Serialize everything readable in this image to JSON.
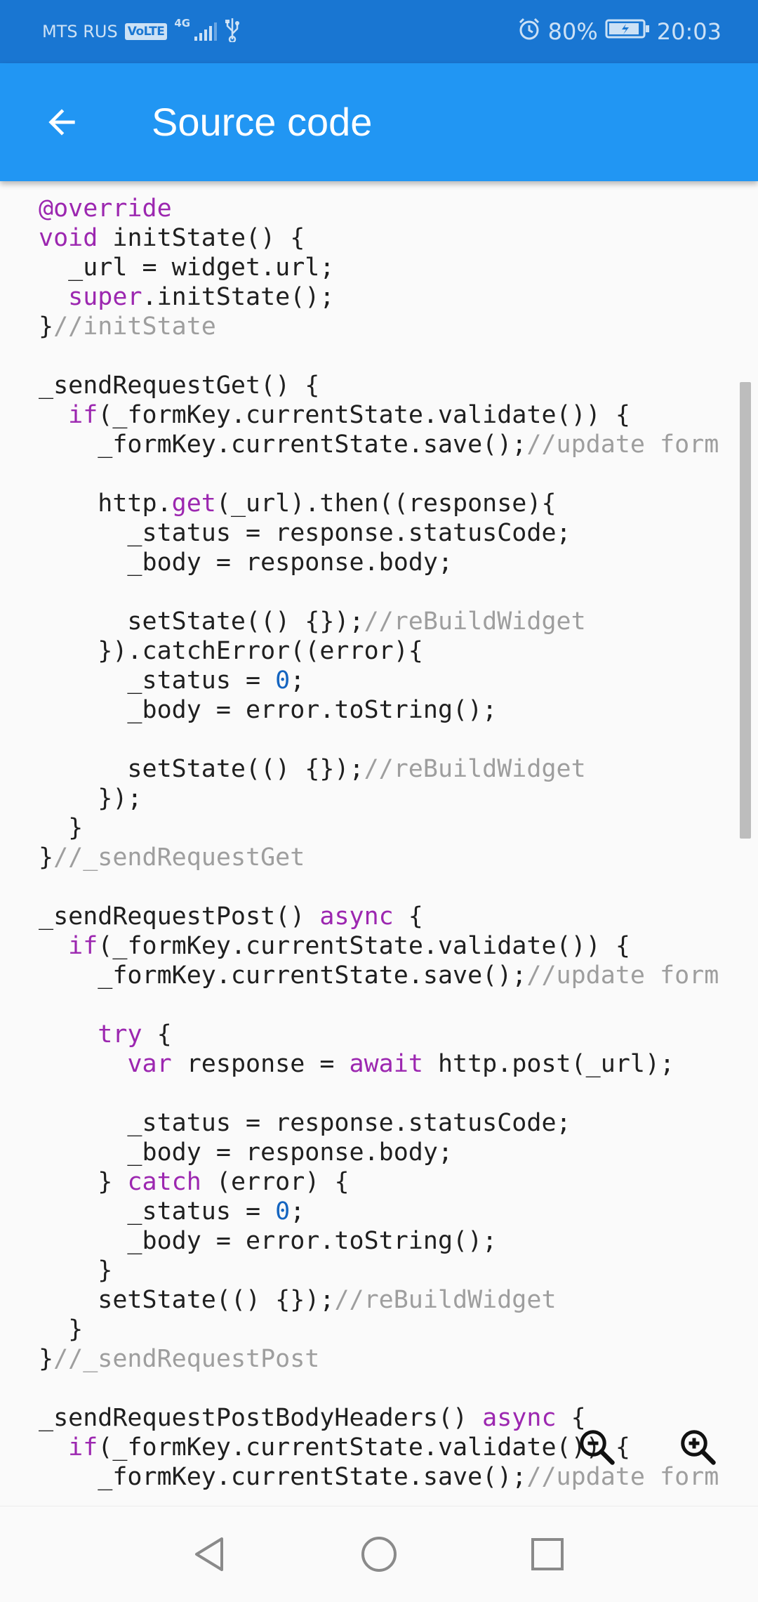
{
  "status_bar": {
    "carrier": "MTS RUS",
    "volte_label": "VoLTE",
    "network_label": "4G",
    "battery_percent": "80%",
    "time": "20:03"
  },
  "app_bar": {
    "title": "Source code",
    "back_icon": "arrow-back-icon"
  },
  "code": {
    "language": "dart",
    "lines": [
      [
        [
          "kw",
          "@override"
        ]
      ],
      [
        [
          "kw",
          "void"
        ],
        [
          "p",
          " initState() {"
        ]
      ],
      [
        [
          "p",
          "  _url = widget.url;"
        ]
      ],
      [
        [
          "p",
          "  "
        ],
        [
          "kw",
          "super"
        ],
        [
          "p",
          ".initState();"
        ]
      ],
      [
        [
          "p",
          "}"
        ],
        [
          "cm",
          "//initState"
        ]
      ],
      [
        [
          "p",
          ""
        ]
      ],
      [
        [
          "p",
          "_sendRequestGet() {"
        ]
      ],
      [
        [
          "p",
          "  "
        ],
        [
          "kw",
          "if"
        ],
        [
          "p",
          "(_formKey.currentState.validate()) {"
        ]
      ],
      [
        [
          "p",
          "    _formKey.currentState.save();"
        ],
        [
          "cm",
          "//update form"
        ]
      ],
      [
        [
          "p",
          ""
        ]
      ],
      [
        [
          "p",
          "    http."
        ],
        [
          "kw",
          "get"
        ],
        [
          "p",
          "(_url).then((response){"
        ]
      ],
      [
        [
          "p",
          "      _status = response.statusCode;"
        ]
      ],
      [
        [
          "p",
          "      _body = response.body;"
        ]
      ],
      [
        [
          "p",
          ""
        ]
      ],
      [
        [
          "p",
          "      setState(() {});"
        ],
        [
          "cm",
          "//reBuildWidget"
        ]
      ],
      [
        [
          "p",
          "    }).catchError((error){"
        ]
      ],
      [
        [
          "p",
          "      _status = "
        ],
        [
          "num",
          "0"
        ],
        [
          "p",
          ";"
        ]
      ],
      [
        [
          "p",
          "      _body = error.toString();"
        ]
      ],
      [
        [
          "p",
          ""
        ]
      ],
      [
        [
          "p",
          "      setState(() {});"
        ],
        [
          "cm",
          "//reBuildWidget"
        ]
      ],
      [
        [
          "p",
          "    });"
        ]
      ],
      [
        [
          "p",
          "  }"
        ]
      ],
      [
        [
          "p",
          "}"
        ],
        [
          "cm",
          "//_sendRequestGet"
        ]
      ],
      [
        [
          "p",
          ""
        ]
      ],
      [
        [
          "p",
          "_sendRequestPost() "
        ],
        [
          "kw",
          "async"
        ],
        [
          "p",
          " {"
        ]
      ],
      [
        [
          "p",
          "  "
        ],
        [
          "kw",
          "if"
        ],
        [
          "p",
          "(_formKey.currentState.validate()) {"
        ]
      ],
      [
        [
          "p",
          "    _formKey.currentState.save();"
        ],
        [
          "cm",
          "//update form"
        ]
      ],
      [
        [
          "p",
          ""
        ]
      ],
      [
        [
          "p",
          "    "
        ],
        [
          "kw",
          "try"
        ],
        [
          "p",
          " {"
        ]
      ],
      [
        [
          "p",
          "      "
        ],
        [
          "kw",
          "var"
        ],
        [
          "p",
          " response = "
        ],
        [
          "kw",
          "await"
        ],
        [
          "p",
          " http.post(_url);"
        ]
      ],
      [
        [
          "p",
          ""
        ]
      ],
      [
        [
          "p",
          "      _status = response.statusCode;"
        ]
      ],
      [
        [
          "p",
          "      _body = response.body;"
        ]
      ],
      [
        [
          "p",
          "    } "
        ],
        [
          "kw",
          "catch"
        ],
        [
          "p",
          " (error) {"
        ]
      ],
      [
        [
          "p",
          "      _status = "
        ],
        [
          "num",
          "0"
        ],
        [
          "p",
          ";"
        ]
      ],
      [
        [
          "p",
          "      _body = error.toString();"
        ]
      ],
      [
        [
          "p",
          "    }"
        ]
      ],
      [
        [
          "p",
          "    setState(() {});"
        ],
        [
          "cm",
          "//reBuildWidget"
        ]
      ],
      [
        [
          "p",
          "  }"
        ]
      ],
      [
        [
          "p",
          "}"
        ],
        [
          "cm",
          "//_sendRequestPost"
        ]
      ],
      [
        [
          "p",
          ""
        ]
      ],
      [
        [
          "p",
          "_sendRequestPostBodyHeaders() "
        ],
        [
          "kw",
          "async"
        ],
        [
          "p",
          " {"
        ]
      ],
      [
        [
          "p",
          "  "
        ],
        [
          "kw",
          "if"
        ],
        [
          "p",
          "(_formKey.currentState.validate()) {"
        ]
      ],
      [
        [
          "p",
          "    _formKey.currentState.save();"
        ],
        [
          "cm",
          "//update form"
        ]
      ]
    ]
  },
  "zoom_controls": {
    "zoom_out_icon": "zoom-out-icon",
    "zoom_in_icon": "zoom-in-icon"
  },
  "nav_bar": {
    "back_icon": "nav-back-icon",
    "home_icon": "nav-home-icon",
    "recents_icon": "nav-recents-icon"
  },
  "colors": {
    "status_bar": "#1976d2",
    "app_bar": "#2196f3",
    "keyword": "#9c27b0",
    "comment": "#9e9e9e",
    "number": "#1565c0",
    "text": "#1f1f1f",
    "background": "#fafafa"
  }
}
